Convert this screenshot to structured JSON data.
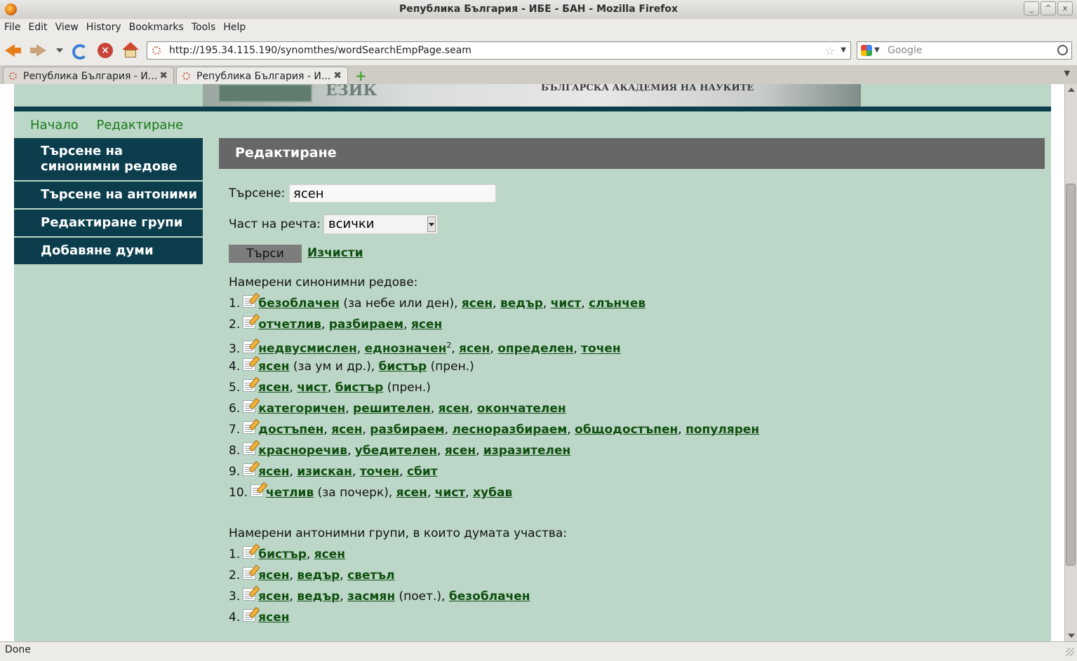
{
  "window": {
    "title": "Република България - ИБЕ - БАН - Mozilla Firefox",
    "controls": [
      "_",
      "^",
      "x"
    ]
  },
  "menu": [
    "File",
    "Edit",
    "View",
    "History",
    "Bookmarks",
    "Tools",
    "Help"
  ],
  "nav": {
    "url": "http://195.34.115.190/synomthes/wordSearchEmpPage.seam",
    "search_placeholder": "Google"
  },
  "tabs": [
    {
      "label": "Република България - И..."
    },
    {
      "label": "Република България - И..."
    }
  ],
  "banner": {
    "title": "ЕЗИК",
    "subtitle": "БЪЛГАРСКА АКАДЕМИЯ НА НАУКИТЕ"
  },
  "topnav": [
    "Начало",
    "Редактиране"
  ],
  "sidebar": [
    {
      "label": "Търсене на синонимни редове"
    },
    {
      "label": "Търсене на антоними"
    },
    {
      "label": "Редактиране групи"
    },
    {
      "label": "Добавяне думи"
    }
  ],
  "main": {
    "heading": "Редактиране",
    "search_label": "Търсене:",
    "search_value": "ясен",
    "pos_label": "Част на речта:",
    "pos_value": "всички",
    "search_button": "Търси",
    "clear_link": "Изчисти",
    "syn_heading": "Намерени синонимни редове:",
    "synonyms": [
      [
        {
          "w": "безоблачен"
        },
        {
          "t": " (за небе или ден), "
        },
        {
          "w": "ясен"
        },
        {
          "t": ", "
        },
        {
          "w": "ведър"
        },
        {
          "t": ", "
        },
        {
          "w": "чист"
        },
        {
          "t": ", "
        },
        {
          "w": "слънчев"
        }
      ],
      [
        {
          "w": "отчетлив"
        },
        {
          "t": ", "
        },
        {
          "w": "разбираем"
        },
        {
          "t": ", "
        },
        {
          "w": "ясен"
        }
      ],
      [
        {
          "w": "недвусмислен"
        },
        {
          "t": ", "
        },
        {
          "w": "еднозначен"
        },
        {
          "s": "2"
        },
        {
          "t": ", "
        },
        {
          "w": "ясен"
        },
        {
          "t": ", "
        },
        {
          "w": "определен"
        },
        {
          "t": ", "
        },
        {
          "w": "точен"
        }
      ],
      [
        {
          "w": "ясен"
        },
        {
          "t": " (за ум и др.), "
        },
        {
          "w": "бистър"
        },
        {
          "t": " (прен.)"
        }
      ],
      [
        {
          "w": "ясен"
        },
        {
          "t": ", "
        },
        {
          "w": "чист"
        },
        {
          "t": ", "
        },
        {
          "w": "бистър"
        },
        {
          "t": " (прен.)"
        }
      ],
      [
        {
          "w": "категоричен"
        },
        {
          "t": ", "
        },
        {
          "w": "решителен"
        },
        {
          "t": ", "
        },
        {
          "w": "ясен"
        },
        {
          "t": ", "
        },
        {
          "w": "окончателен"
        }
      ],
      [
        {
          "w": "достъпен"
        },
        {
          "t": ", "
        },
        {
          "w": "ясен"
        },
        {
          "t": ", "
        },
        {
          "w": "разбираем"
        },
        {
          "t": ", "
        },
        {
          "w": "лесноразбираем"
        },
        {
          "t": ", "
        },
        {
          "w": "общодостъпен"
        },
        {
          "t": ", "
        },
        {
          "w": "популярен"
        }
      ],
      [
        {
          "w": "красноречив"
        },
        {
          "t": ", "
        },
        {
          "w": "убедителен"
        },
        {
          "t": ", "
        },
        {
          "w": "ясен"
        },
        {
          "t": ", "
        },
        {
          "w": "изразителен"
        }
      ],
      [
        {
          "w": "ясен"
        },
        {
          "t": ", "
        },
        {
          "w": "изискан"
        },
        {
          "t": ", "
        },
        {
          "w": "точен"
        },
        {
          "t": ", "
        },
        {
          "w": "сбит"
        }
      ],
      [
        {
          "w": "четлив"
        },
        {
          "t": " (за почерк), "
        },
        {
          "w": "ясен"
        },
        {
          "t": ", "
        },
        {
          "w": "чист"
        },
        {
          "t": ", "
        },
        {
          "w": "хубав"
        }
      ]
    ],
    "ant_heading": "Намерени антонимни групи, в които думата участва:",
    "antonyms": [
      [
        {
          "w": "бистър"
        },
        {
          "t": ", "
        },
        {
          "w": "ясен"
        }
      ],
      [
        {
          "w": "ясен"
        },
        {
          "t": ", "
        },
        {
          "w": "ведър"
        },
        {
          "t": ", "
        },
        {
          "w": "светъл"
        }
      ],
      [
        {
          "w": "ясен"
        },
        {
          "t": ", "
        },
        {
          "w": "ведър"
        },
        {
          "t": ", "
        },
        {
          "w": "засмян"
        },
        {
          "t": " (поет.), "
        },
        {
          "w": "безоблачен"
        }
      ],
      [
        {
          "w": "ясен"
        }
      ]
    ]
  },
  "status": "Done"
}
